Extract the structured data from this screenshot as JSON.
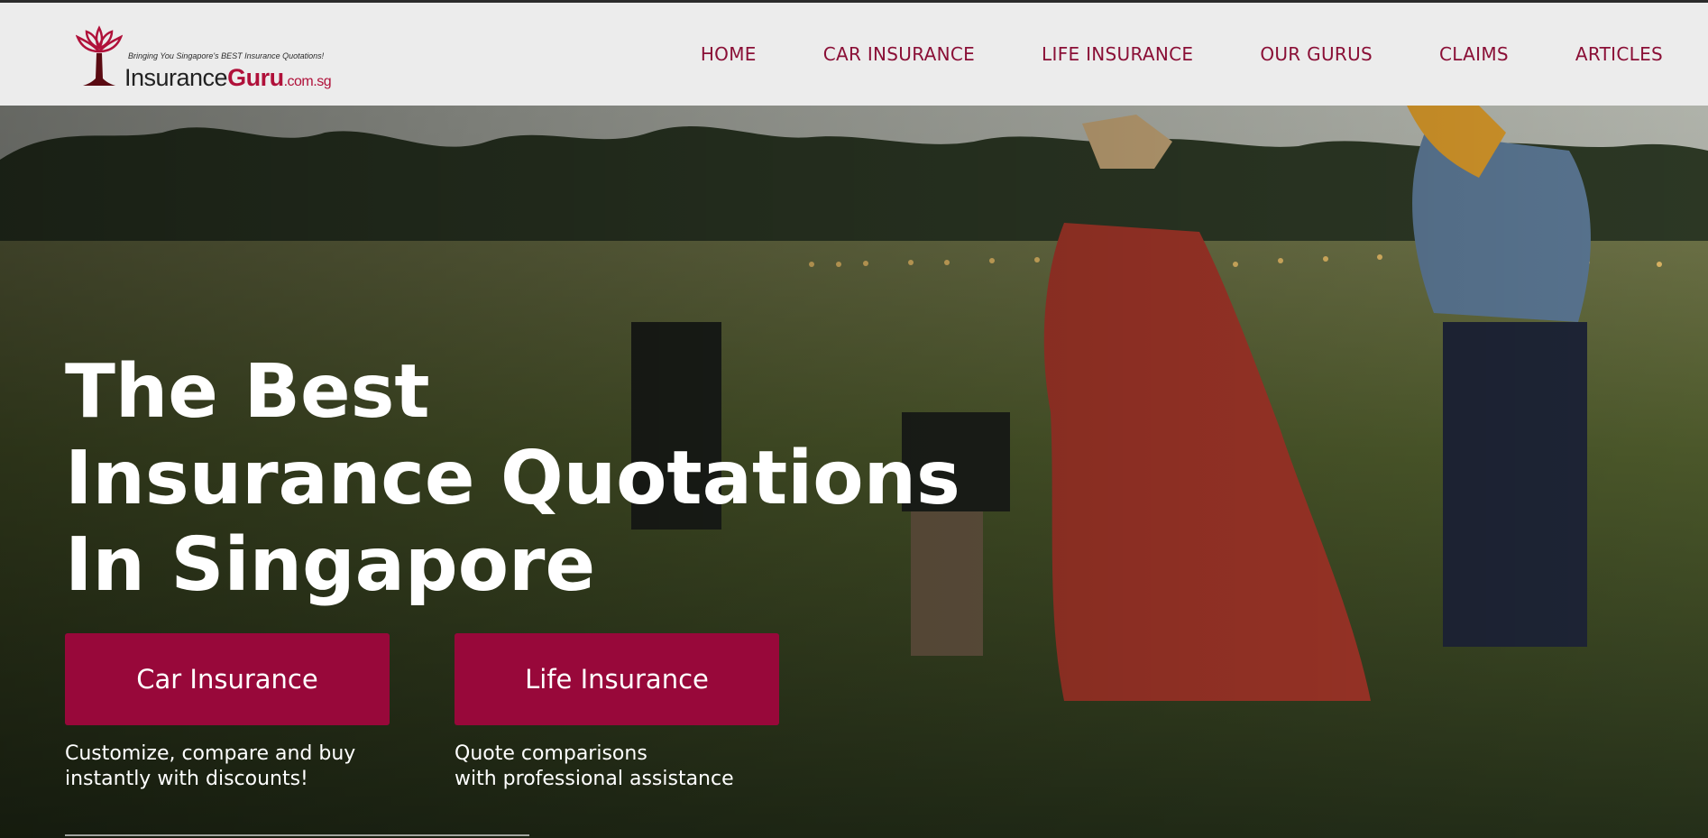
{
  "header": {
    "logo": {
      "tagline": "Bringing You Singapore's BEST Insurance Quotations!",
      "word_main": "Insurance",
      "word_brand": "Guru",
      "word_tld": ".com.sg"
    },
    "nav": [
      "HOME",
      "CAR INSURANCE",
      "LIFE INSURANCE",
      "OUR GURUS",
      "CLAIMS",
      "ARTICLES"
    ]
  },
  "hero": {
    "headline": [
      "The Best",
      "Insurance Quotations",
      "In Singapore"
    ],
    "ctas": [
      {
        "label": "Car Insurance",
        "description": [
          "Customize, compare and buy",
          "instantly with discounts!"
        ]
      },
      {
        "label": "Life Insurance",
        "description": [
          "Quote comparisons",
          "with professional assistance"
        ]
      }
    ]
  },
  "colors": {
    "brand": "#98083a",
    "nav_text": "#8a0f36",
    "header_bg": "#ececec"
  },
  "icons": {
    "logo_mark": "lotus-tree-icon"
  }
}
